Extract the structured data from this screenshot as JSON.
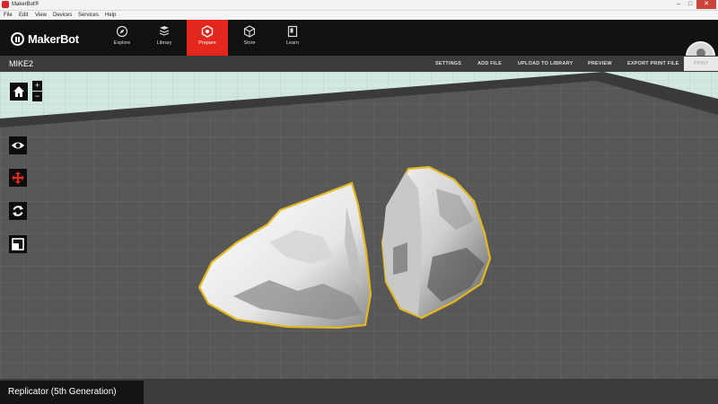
{
  "window": {
    "title": "MakerBot®"
  },
  "menu": [
    "File",
    "Edit",
    "View",
    "Devices",
    "Services",
    "Help"
  ],
  "nav": {
    "logo_text": "MakerBot",
    "tabs": [
      {
        "label": "Explore",
        "icon": "compass-icon"
      },
      {
        "label": "Library",
        "icon": "library-icon"
      },
      {
        "label": "Prepare",
        "icon": "prepare-icon",
        "active": true
      },
      {
        "label": "Store",
        "icon": "cube-icon"
      },
      {
        "label": "Learn",
        "icon": "book-icon"
      }
    ]
  },
  "toolbar": {
    "file_name": "MIKE2",
    "actions": [
      "SETTINGS",
      "ADD FILE",
      "UPLOAD TO LIBRARY",
      "PREVIEW",
      "EXPORT PRINT FILE"
    ],
    "print_label": "PRINT"
  },
  "status": {
    "printer": "Replicator (5th Generation)"
  },
  "colors": {
    "accent": "#e4281e",
    "selection": "#e2b720",
    "plate": "#555555"
  }
}
